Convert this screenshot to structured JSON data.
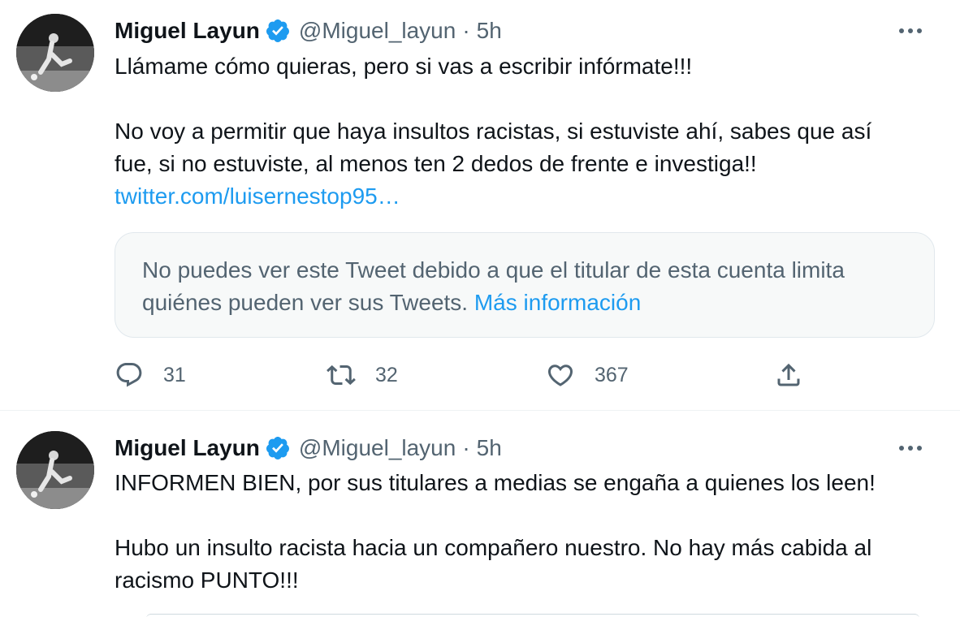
{
  "colors": {
    "text": "#0f1419",
    "secondary": "#536471",
    "link": "#1d9bf0",
    "verified": "#1d9bf0",
    "divider": "#eff3f4"
  },
  "tweets": [
    {
      "author": {
        "name": "Miguel Layun",
        "handle": "@Miguel_layun",
        "separator": "·",
        "time": "5h",
        "verified_icon": "verified-badge-icon"
      },
      "body": [
        "Llámame cómo quieras, pero si vas a escribir infórmate!!!",
        "No voy a permitir que haya insultos racistas, si estuviste ahí, sabes que así",
        "fue, si no estuviste, al menos ten 2 dedos de frente e investiga!!"
      ],
      "link": "twitter.com/luisernestop95…",
      "quote": {
        "line1": "No puedes ver este Tweet debido a que el titular de esta cuenta limita",
        "line2": "quiénes pueden ver sus Tweets.",
        "more_link": "Más información"
      },
      "actions": {
        "replies": "31",
        "retweets": "32",
        "likes": "367"
      }
    },
    {
      "author": {
        "name": "Miguel Layun",
        "handle": "@Miguel_layun",
        "separator": "·",
        "time": "5h",
        "verified_icon": "verified-badge-icon"
      },
      "body": [
        "INFORMEN BIEN, por sus titulares a medias se engaña a quienes los leen!",
        "Hubo un insulto racista hacia un compañero nuestro. No hay más cabida al",
        "racismo PUNTO!!!"
      ]
    }
  ]
}
